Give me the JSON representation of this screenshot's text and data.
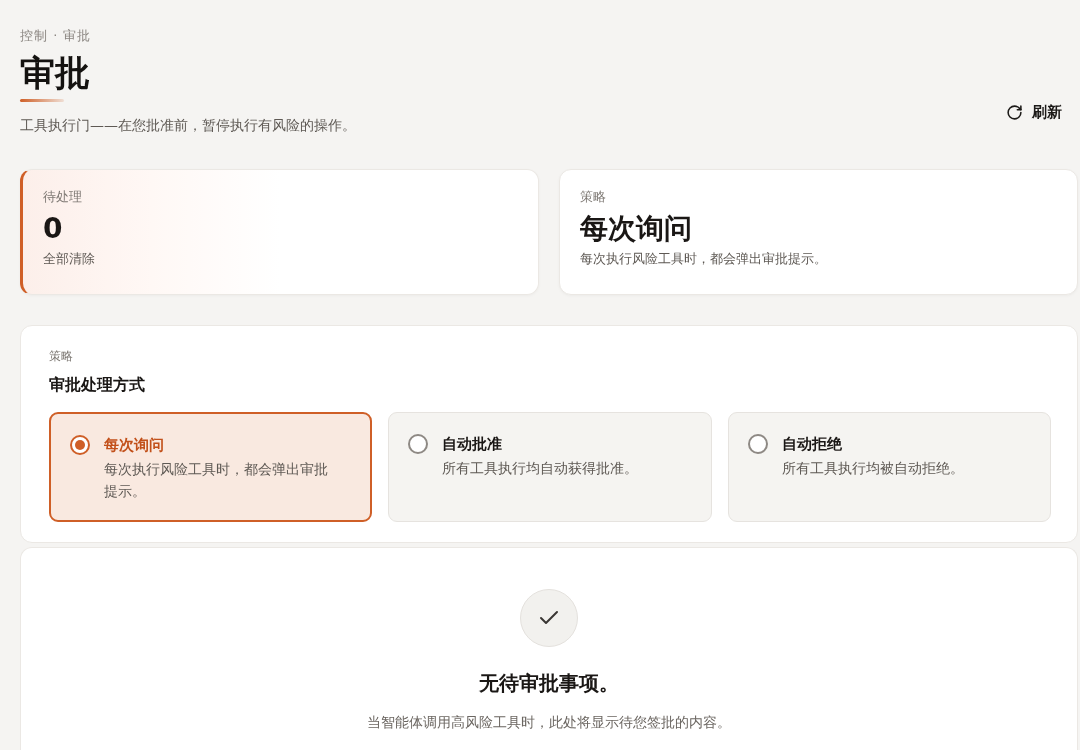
{
  "breadcrumb": "控制 · 审批",
  "title": "审批",
  "subtitle": "工具执行门——在您批准前，暂停执行有风险的操作。",
  "refresh_button": {
    "label": "刷新"
  },
  "stats": [
    {
      "label": "待处理",
      "value": "0",
      "note": "全部清除",
      "accent": true
    },
    {
      "label": "策略",
      "value": "每次询问",
      "note": "每次执行风险工具时，都会弹出审批提示。",
      "accent": false
    }
  ],
  "policy": {
    "eyebrow": "策略",
    "title": "审批处理方式",
    "options": [
      {
        "title": "每次询问",
        "description": "每次执行风险工具时，都会弹出审批提示。",
        "selected": true
      },
      {
        "title": "自动批准",
        "description": "所有工具执行均自动获得批准。",
        "selected": false
      },
      {
        "title": "自动拒绝",
        "description": "所有工具执行均被自动拒绝。",
        "selected": false
      }
    ]
  },
  "empty_state": {
    "title": "无待审批事项。",
    "description": "当智能体调用高风险工具时，此处将显示待您签批的内容。"
  }
}
